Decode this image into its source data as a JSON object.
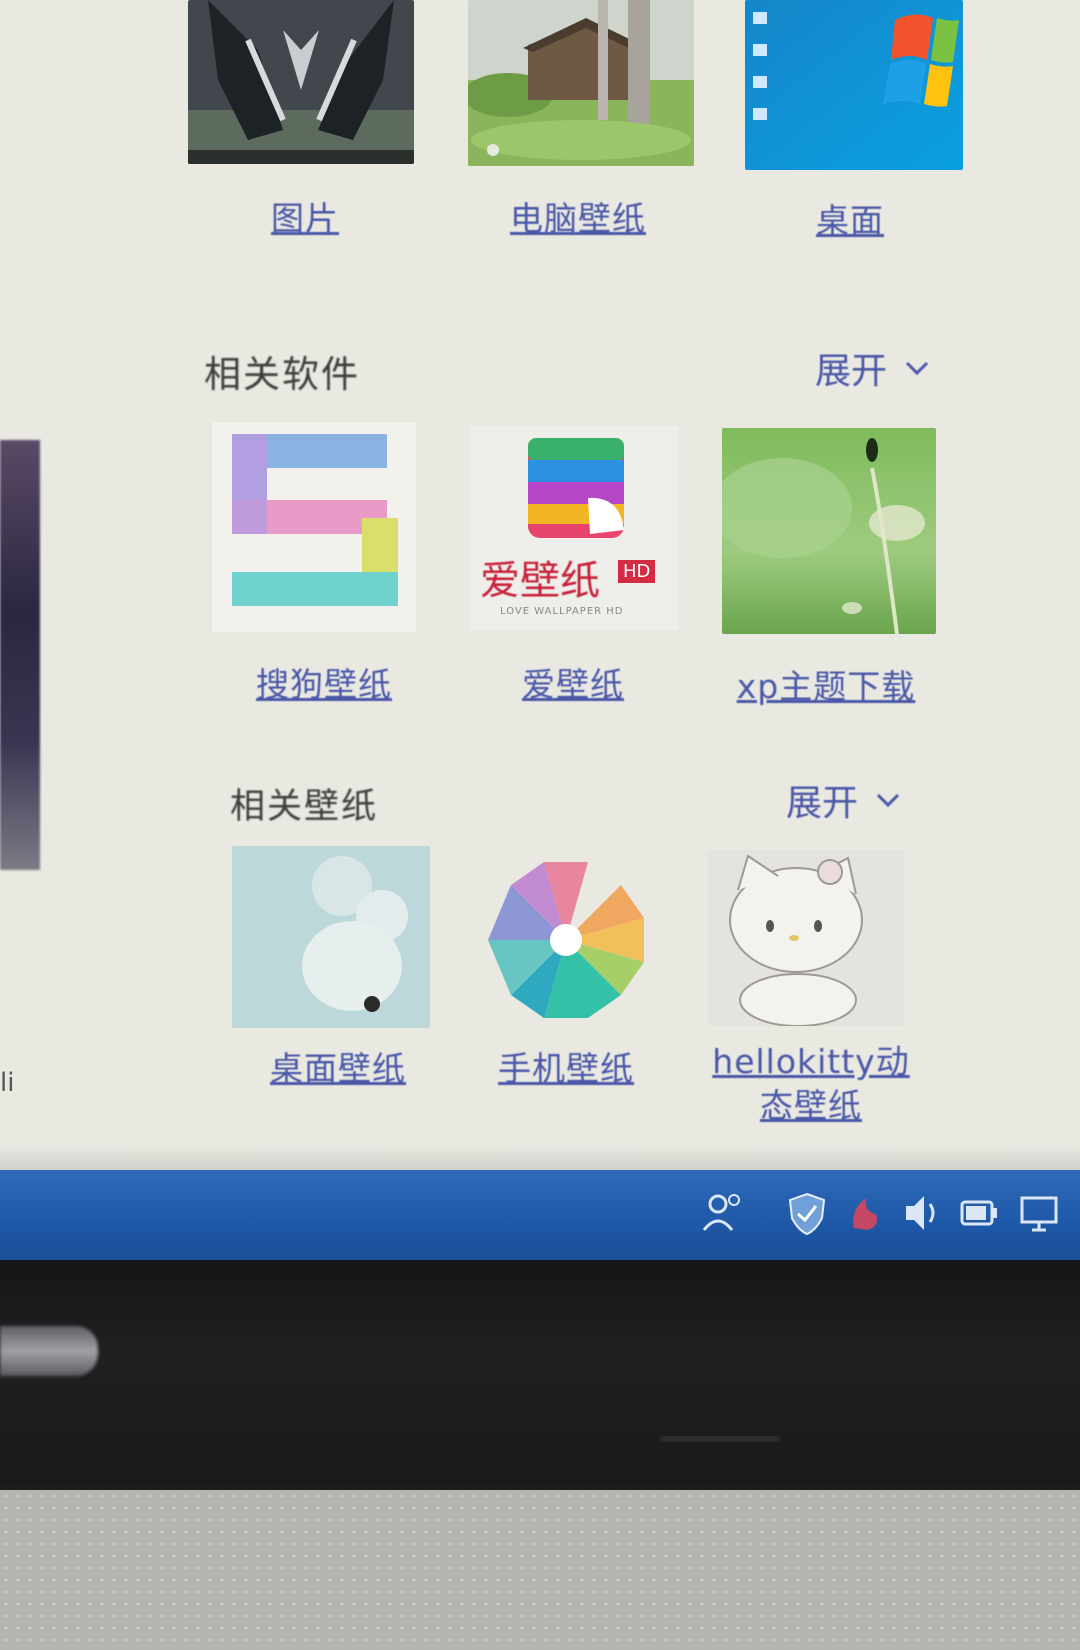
{
  "top_row": {
    "items": [
      {
        "label": "图片"
      },
      {
        "label": "电脑壁纸"
      },
      {
        "label": "桌面"
      }
    ]
  },
  "related_software": {
    "title": "相关软件",
    "expand_label": "展开",
    "items": [
      {
        "label": "搜狗壁纸",
        "icon": "sogou-s-icon"
      },
      {
        "label": "爱壁纸",
        "icon": "ai-bizhi-icon",
        "icon_text": "爱壁纸",
        "icon_badge": "HD",
        "icon_subtext": "LOVE WALLPAPER HD"
      },
      {
        "label": "xp主题下载",
        "icon": "green-nature-image"
      }
    ]
  },
  "related_wallpapers": {
    "title": "相关壁纸",
    "expand_label": "展开",
    "items": [
      {
        "label": "桌面壁纸"
      },
      {
        "label": "手机壁纸"
      },
      {
        "label_line1": "hellokitty动",
        "label_line2": "态壁纸"
      }
    ]
  },
  "colors": {
    "link": "#4a58a8",
    "page_bg": "#e9e8e1",
    "taskbar": "#1e58a7"
  }
}
